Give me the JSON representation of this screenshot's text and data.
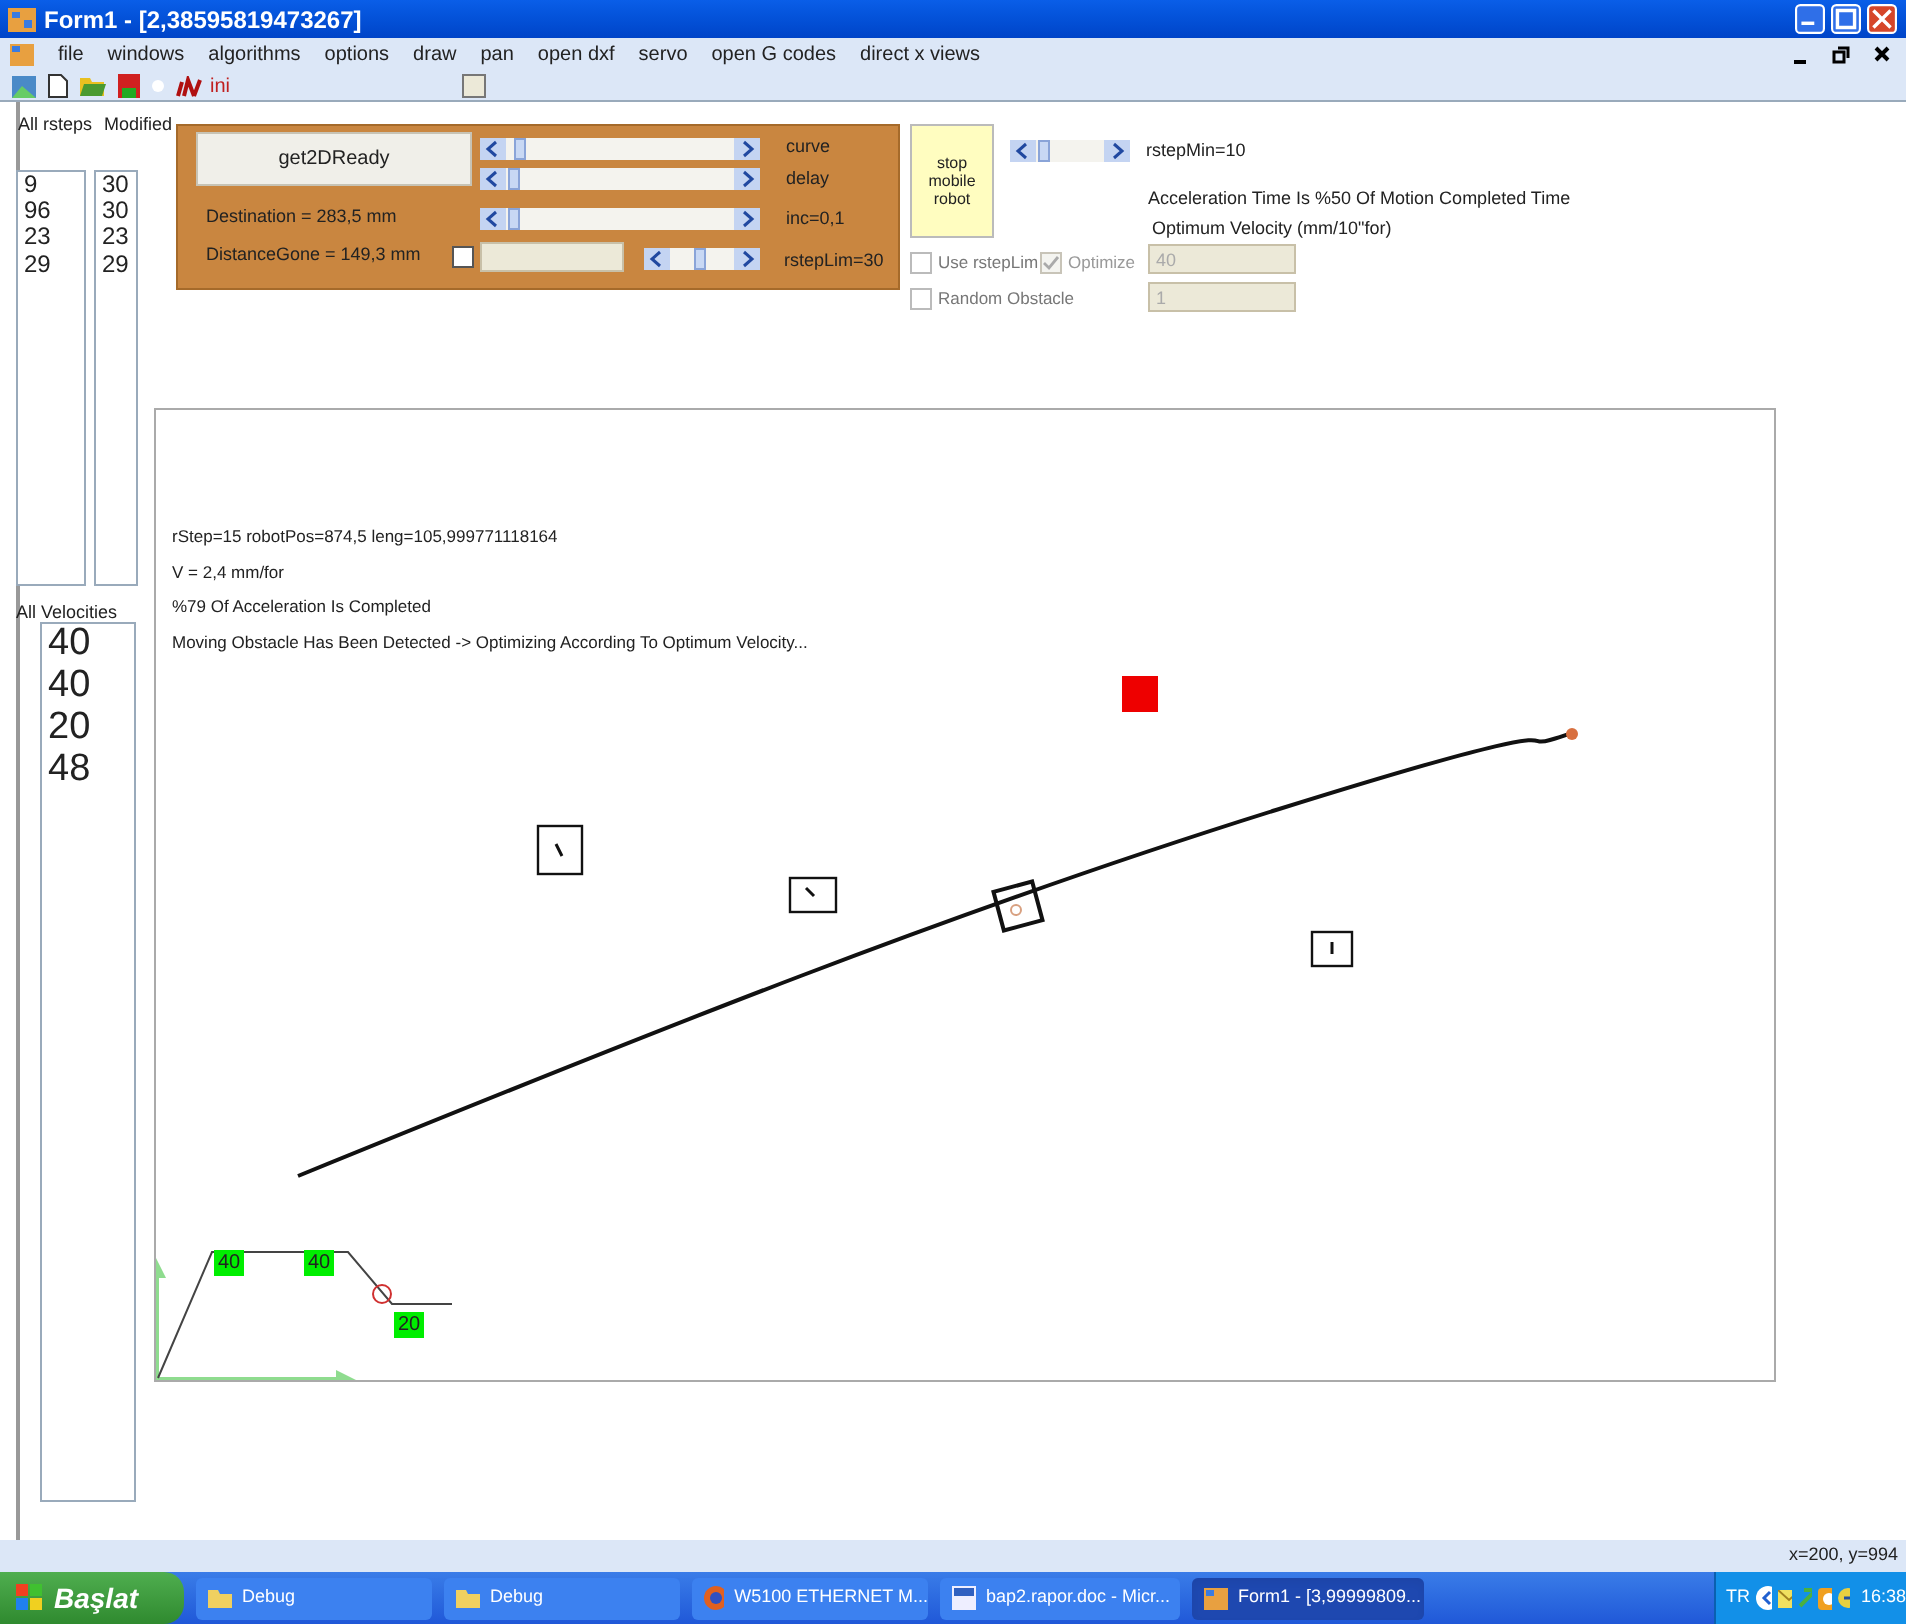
{
  "window": {
    "title": "Form1 - [2,38595819473267]"
  },
  "menu": [
    "file",
    "windows",
    "algorithms",
    "options",
    "draw",
    "pan",
    "open dxf",
    "servo",
    "open G codes",
    "direct x views"
  ],
  "toolbar": {
    "label": "ini",
    "checkbox": {
      "checked": false
    }
  },
  "lists": [
    {
      "label": "All rsteps",
      "items": [
        "9",
        "96",
        "23",
        "29"
      ]
    },
    {
      "label": "Modified",
      "items": [
        "30",
        "30",
        "23",
        "29"
      ]
    },
    {
      "label": "All Velocities",
      "items": [
        "40",
        "40",
        "20",
        "48"
      ]
    }
  ],
  "panel": {
    "button": "get2DReady",
    "destination": "Destination = 283,5 mm",
    "distance_gone": "DistanceGone = 149,3 mm",
    "checkbox": {
      "checked": false
    },
    "sliders": [
      {
        "label": "curve"
      },
      {
        "label": "delay"
      },
      {
        "label": "inc=0,1"
      }
    ],
    "rsteplim": {
      "label": "rstepLim=30"
    }
  },
  "stop_button": "stop mobile robot",
  "rstepmin": {
    "label": "rstepMin=10"
  },
  "acceleration_note": "Acceleration Time Is %50 Of Motion Completed Time",
  "optimum_velocity_label": "Optimum Velocity (mm/10\"for)",
  "options": [
    {
      "label": "Use rstepLim",
      "checked": false,
      "disabled": false
    },
    {
      "label": "Optimize",
      "checked": true,
      "disabled": true
    },
    {
      "label": "Random Obstacle",
      "checked": false,
      "disabled": false
    }
  ],
  "fields": [
    {
      "value": "40"
    },
    {
      "value": "1"
    }
  ],
  "canvas": {
    "lines": [
      "rStep=15  robotPos=874,5 leng=105,999771118164",
      "V = 2,4 mm/for",
      "%79 Of Acceleration Is Completed",
      "Moving Obstacle Has Been Detected -> Optimizing According To Optimum Velocity..."
    ],
    "profile_labels": [
      "40",
      "40",
      "20"
    ]
  },
  "status_bar": {
    "coords": "x=200, y=994"
  },
  "taskbar": {
    "start": "Başlat",
    "tasks": [
      {
        "label": "Debug",
        "selected": false
      },
      {
        "label": "Debug",
        "selected": false
      },
      {
        "label": "W5100 ETHERNET M...",
        "selected": false
      },
      {
        "label": "bap2.rapor.doc - Micr...",
        "selected": false
      },
      {
        "label": "Form1 - [3,99999809...",
        "selected": true
      }
    ],
    "language": "TR",
    "time": "16:38"
  }
}
